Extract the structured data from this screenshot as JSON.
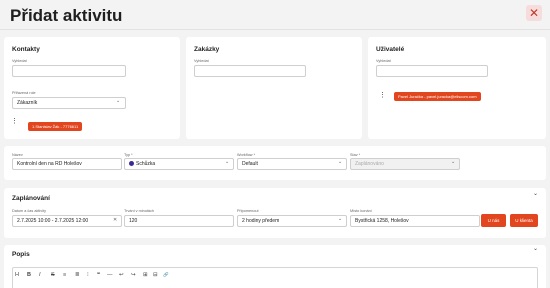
{
  "header": {
    "title": "Přidat aktivitu",
    "close_icon": "close-icon"
  },
  "contacts": {
    "title": "Kontakty",
    "search_label": "Vyhledat",
    "search_value": "",
    "role_label": "Přiřazená role",
    "role_value": "Zákazník",
    "chip": "1.Stanislav Žák - 7776611"
  },
  "orders": {
    "title": "Zakázky",
    "search_label": "Vyhledat",
    "search_value": ""
  },
  "users": {
    "title": "Uživatelé",
    "search_label": "Vyhledat",
    "search_value": "",
    "chip": "Pavel Juračka - pavel.juracka@eliscom.com"
  },
  "details": {
    "name_label": "Název",
    "name_value": "Kontrolní den na RD Holešov",
    "type_label": "Typ *",
    "type_value": "Schůzka",
    "workflow_label": "Workflow *",
    "workflow_value": "Default",
    "state_label": "Stav *",
    "state_value": "Zaplánováno"
  },
  "planning": {
    "title": "Zaplánování",
    "date_label": "Datum a čas aktivity",
    "date_value": "2.7.2025 10:00 - 2.7.2025 12:00",
    "duration_label": "Trvání v minutách",
    "duration_value": "120",
    "reminder_label": "Připomenout",
    "reminder_value": "2 hodiny předem",
    "place_label": "Místo konání",
    "place_value": "Bystřická 1258, Holešov",
    "btn_customer": "U nás",
    "btn_client": "U klienta"
  },
  "description": {
    "title": "Popis",
    "toolbar": [
      "H",
      "B",
      "I",
      "S",
      "≡",
      "≣",
      "⁝",
      "❝",
      "—",
      "↩",
      "↪",
      "⊞",
      "⊟",
      "🔗"
    ]
  },
  "colors": {
    "accent": "#e2461f",
    "type_dot": "#3b2a91"
  }
}
